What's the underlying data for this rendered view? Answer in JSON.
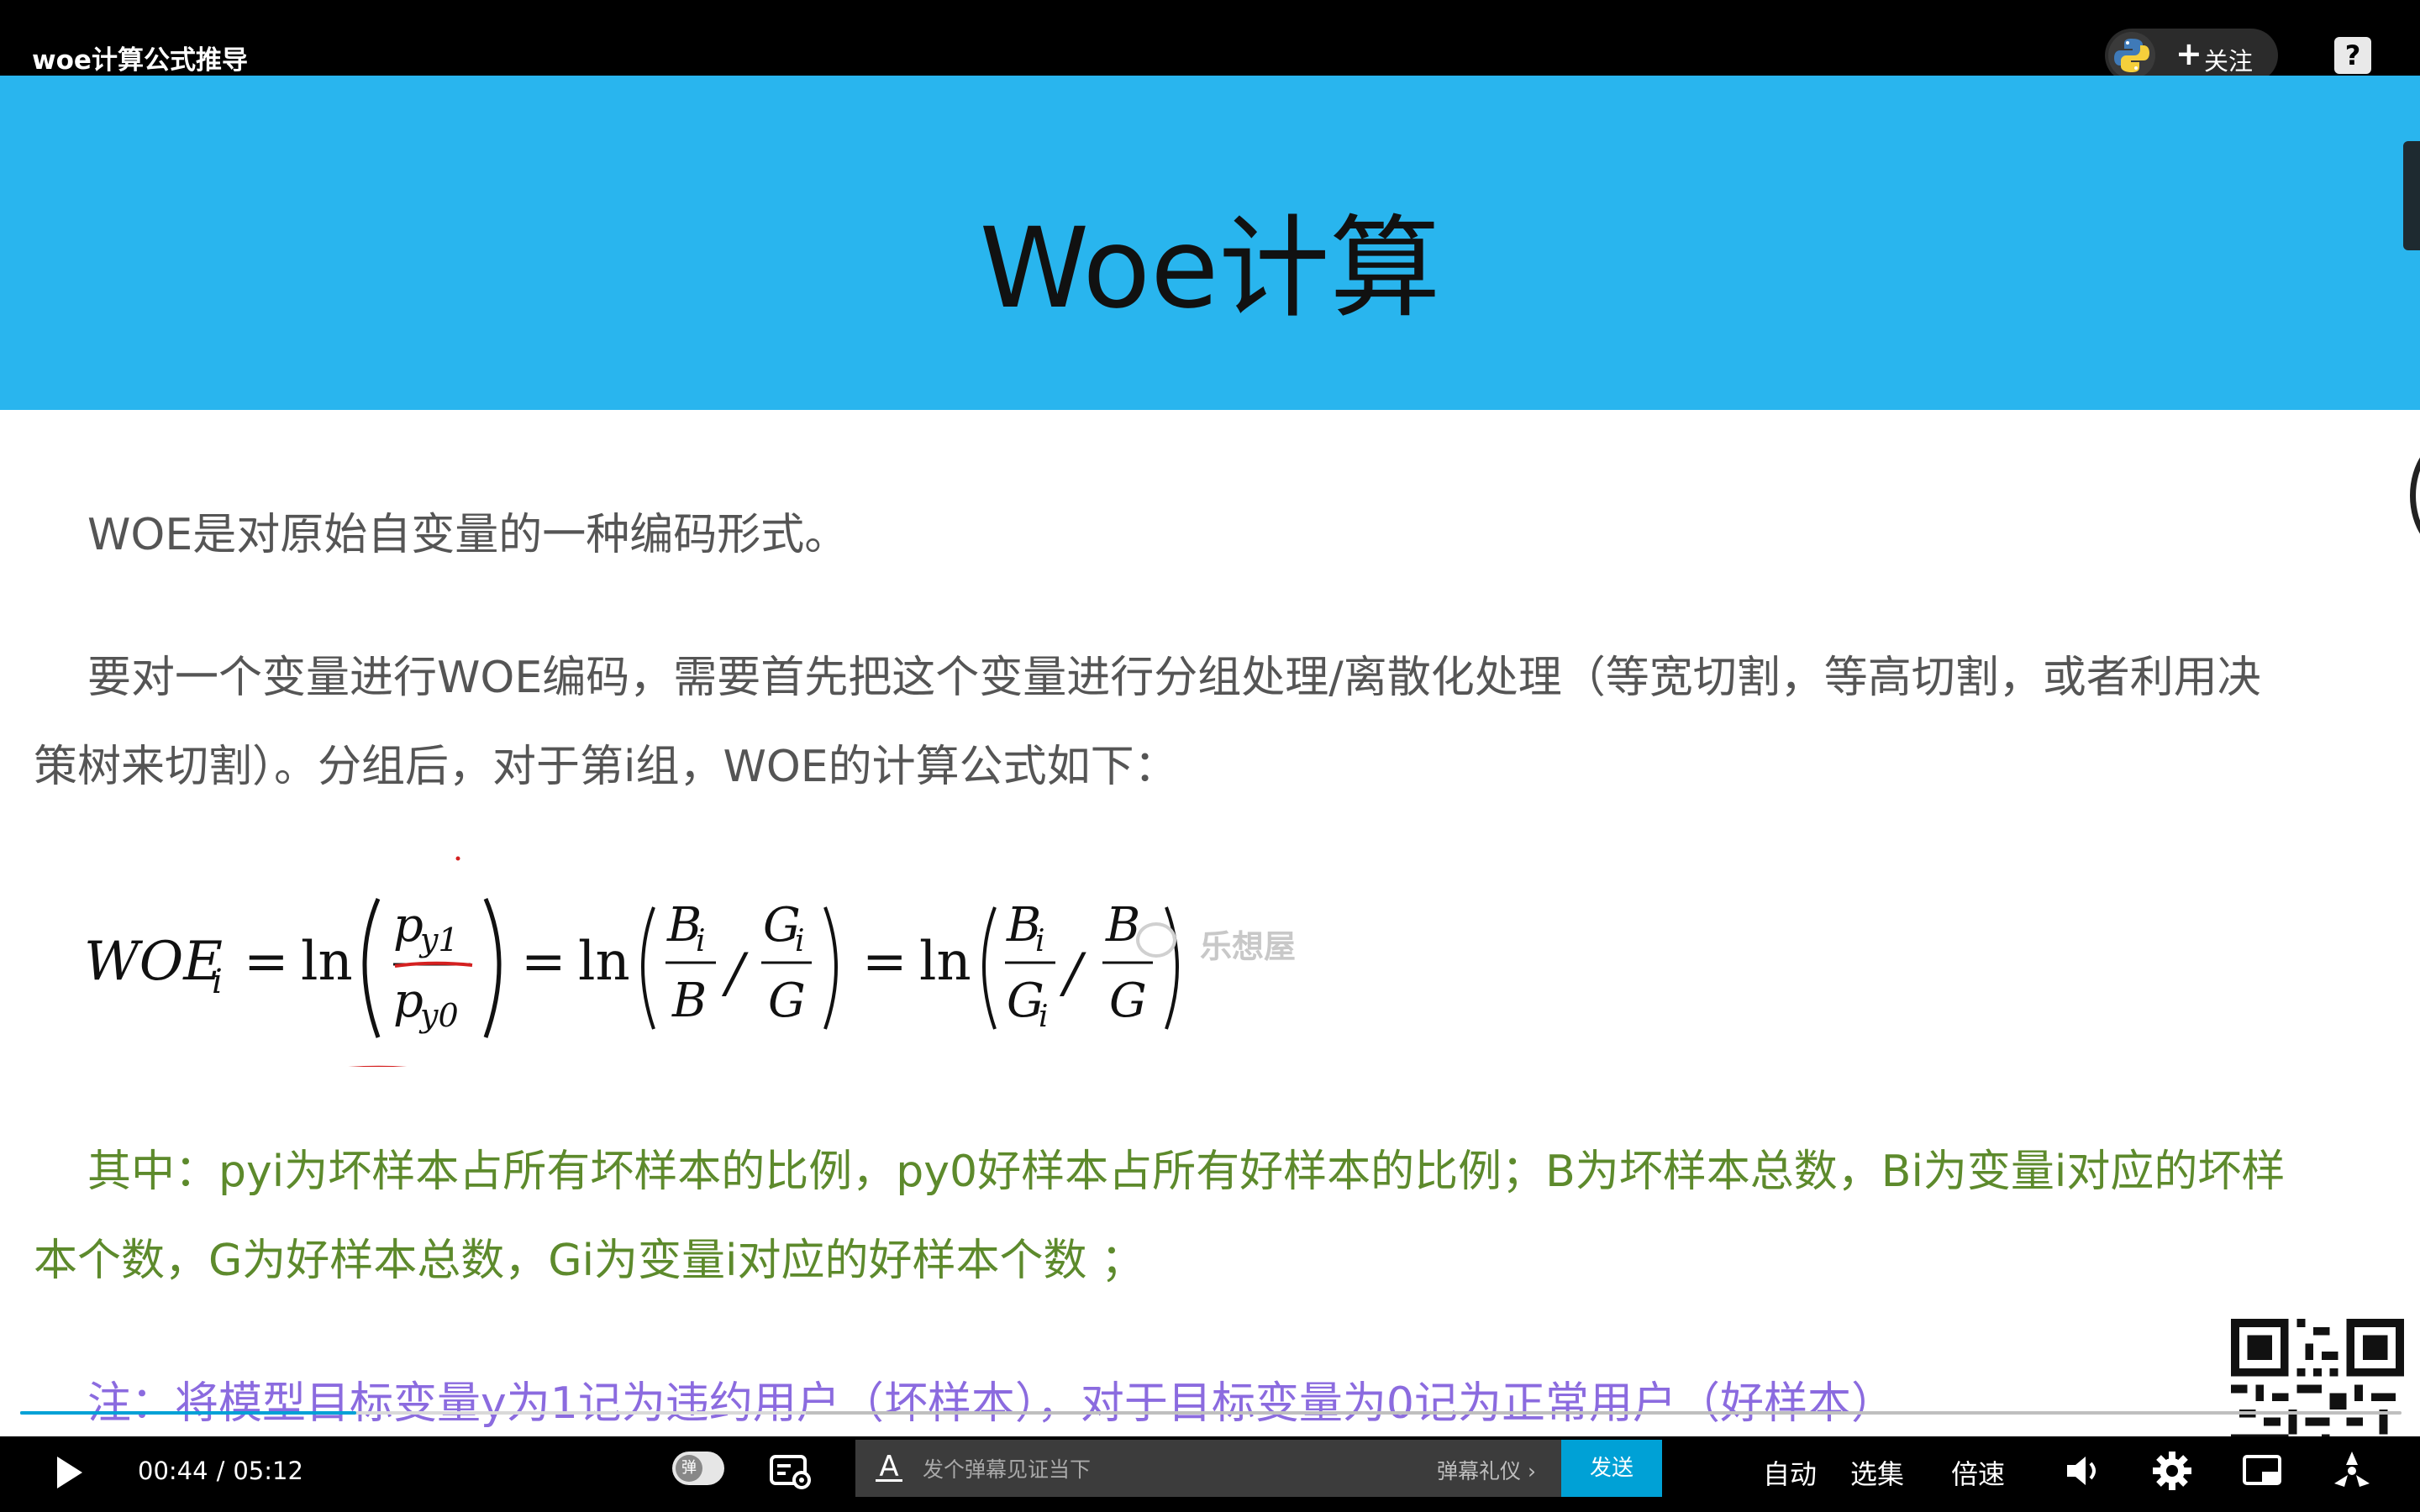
{
  "window": {
    "title": "woe计算公式推导"
  },
  "uploader": {
    "follow_label": "关注",
    "follow_plus": "+"
  },
  "help": {
    "label": "?"
  },
  "slide": {
    "title": "Woe计算",
    "para1": "WOE是对原始自变量的一种编码形式。",
    "para2_line1": "要对一个变量进行WOE编码，需要首先把这个变量进行分组处理/离散化处理（等宽切割，等高切割，或者利用决",
    "para2_line2": "策树来切割）。分组后，对于第i组，WOE的计算公式如下：",
    "formula": {
      "lhs": "WOE",
      "lhs_sub": "i",
      "eq": "=",
      "ln": "ln",
      "p": "p",
      "y1": "y1",
      "y0": "y0",
      "B": "B",
      "G": "G",
      "i": "i",
      "slash": "/"
    },
    "watermark": "乐想屋",
    "para3_line1": "其中：pyi为坏样本占所有坏样本的比例，py0好样本占所有好样本的比例；B为坏样本总数，Bi为变量i对应的坏样",
    "para3_line2": "本个数，G为好样本总数，Gi为变量i对应的好样本个数 ；",
    "note": "注：将模型目标变量y为1记为违约用户（坏样本），对于目标变量为0记为正常用户（好样本）",
    "colors": {
      "header_bg": "#29b5ee",
      "green_text": "#5d8a2c",
      "purple_text": "#8b6bdf"
    }
  },
  "player": {
    "current_time": "00:44",
    "separator": "/",
    "duration": "05:12",
    "progress_fraction": 0.141,
    "buffered_fraction": 0.33,
    "danmaku_toggle_label": "弹",
    "danmaku_style_icon": "A",
    "danmaku_placeholder": "发个弹幕见证当下",
    "danmaku_etiquette": "弹幕礼仪 ›",
    "send_label": "发送",
    "auto_label": "自动",
    "episodes_label": "选集",
    "speed_label": "倍速",
    "accent_color": "#00a1d6"
  }
}
